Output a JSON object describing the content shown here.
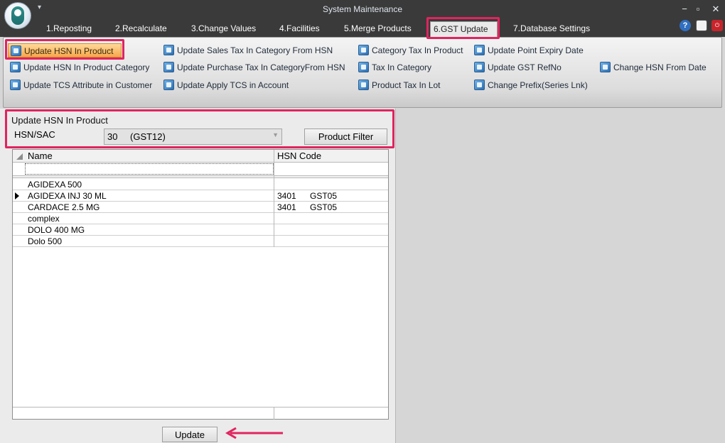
{
  "window": {
    "title": "System Maintenance",
    "controls": {
      "minimize": "−",
      "maximize": "▫",
      "close": "✕"
    },
    "qat_icon": "dropdown-arrow-icon"
  },
  "tabs": [
    {
      "label": "1.Reposting"
    },
    {
      "label": "2.Recalculate"
    },
    {
      "label": "3.Change Values"
    },
    {
      "label": "4.Facilities"
    },
    {
      "label": "5.Merge Products"
    },
    {
      "label": "6.GST Update",
      "active": true
    },
    {
      "label": "7.Database Settings"
    }
  ],
  "ribbon": {
    "col1": [
      {
        "label": "Update HSN In Product",
        "selected": true
      },
      {
        "label": "Update HSN In Product Category"
      },
      {
        "label": "Update TCS Attribute in Customer"
      }
    ],
    "col2": [
      {
        "label": "Update Sales Tax In Category From HSN"
      },
      {
        "label": "Update Purchase Tax In CategoryFrom HSN"
      },
      {
        "label": "Update Apply TCS in Account"
      }
    ],
    "col3": [
      {
        "label": "Category Tax In Product"
      },
      {
        "label": "Tax In Category"
      },
      {
        "label": "Product Tax In Lot"
      }
    ],
    "col4": [
      {
        "label": "Update Point Expiry Date"
      },
      {
        "label": "Update GST RefNo"
      },
      {
        "label": "Change Prefix(Series Lnk)"
      }
    ],
    "col5": [
      {
        "label": "Change HSN From Date"
      }
    ]
  },
  "form": {
    "title": "Update HSN In Product",
    "hsn_label": "HSN/SAC",
    "hsn_code": "30",
    "hsn_category": "(GST12)",
    "product_filter_label": "Product Filter",
    "update_label": "Update"
  },
  "grid": {
    "columns": [
      "Name",
      "HSN Code"
    ],
    "rows": [
      {
        "name": "AGIDEXA 500",
        "hsn": "",
        "gst": ""
      },
      {
        "name": "AGIDEXA INJ 30 ML",
        "hsn": "3401",
        "gst": "GST05",
        "current": true
      },
      {
        "name": "CARDACE 2.5 MG",
        "hsn": "3401",
        "gst": "GST05"
      },
      {
        "name": "complex",
        "hsn": "",
        "gst": ""
      },
      {
        "name": "DOLO 400 MG",
        "hsn": "",
        "gst": ""
      },
      {
        "name": "Dolo 500",
        "hsn": "",
        "gst": ""
      }
    ]
  },
  "colors": {
    "highlight": "#e0245f",
    "selected_button": "#f6a74a",
    "titlebar": "#3a3a3a"
  }
}
